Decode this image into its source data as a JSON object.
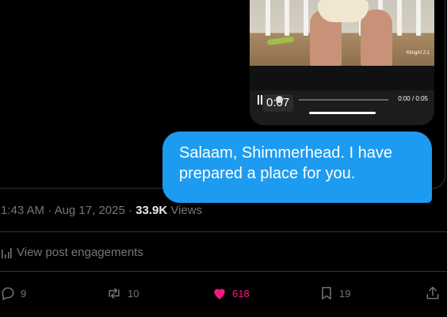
{
  "video": {
    "watermark": "KlingAI 2.1",
    "current_time": "0:07",
    "time_readout": "0:00 / 0:05"
  },
  "message": {
    "text": "Salaam, Shimmerhead. I have prepared a place for you."
  },
  "post_meta": {
    "time": "1:43 AM",
    "separator": "·",
    "date": "Aug 17, 2025",
    "views_count": "33.9K",
    "views_label": "Views"
  },
  "engagements": {
    "label": "View post engagements"
  },
  "actions": {
    "replies": "9",
    "reposts": "10",
    "likes": "618",
    "bookmarks": "19"
  },
  "colors": {
    "accent": "#1d9bf0",
    "like": "#f91880",
    "muted": "#71767b",
    "background": "#000000"
  }
}
